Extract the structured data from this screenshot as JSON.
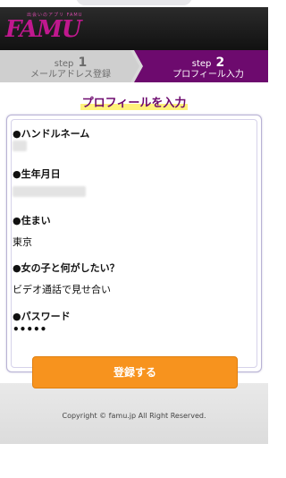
{
  "header": {
    "logo_tagline": "出会いのアプリ FAMU",
    "logo_text": "FAMU"
  },
  "steps": [
    {
      "step_word": "step",
      "number": "1",
      "label": "メールアドレス登録"
    },
    {
      "step_word": "step",
      "number": "2",
      "label": "プロフィール入力"
    }
  ],
  "page_title": "プロフィールを入力",
  "fields": {
    "handle_label": "●ハンドルネーム",
    "birthday_label": "●生年月日",
    "residence_label": "●住まい",
    "residence_value": "東京",
    "wish_label": "●女の子と何がしたい？",
    "wish_value": "ビデオ通話で見せ合い",
    "password_label": "●パスワード",
    "password_value": "•••••"
  },
  "submit_label": "登録する",
  "footer": {
    "copyright": "Copyright © famu.jp All Right Reserved."
  }
}
